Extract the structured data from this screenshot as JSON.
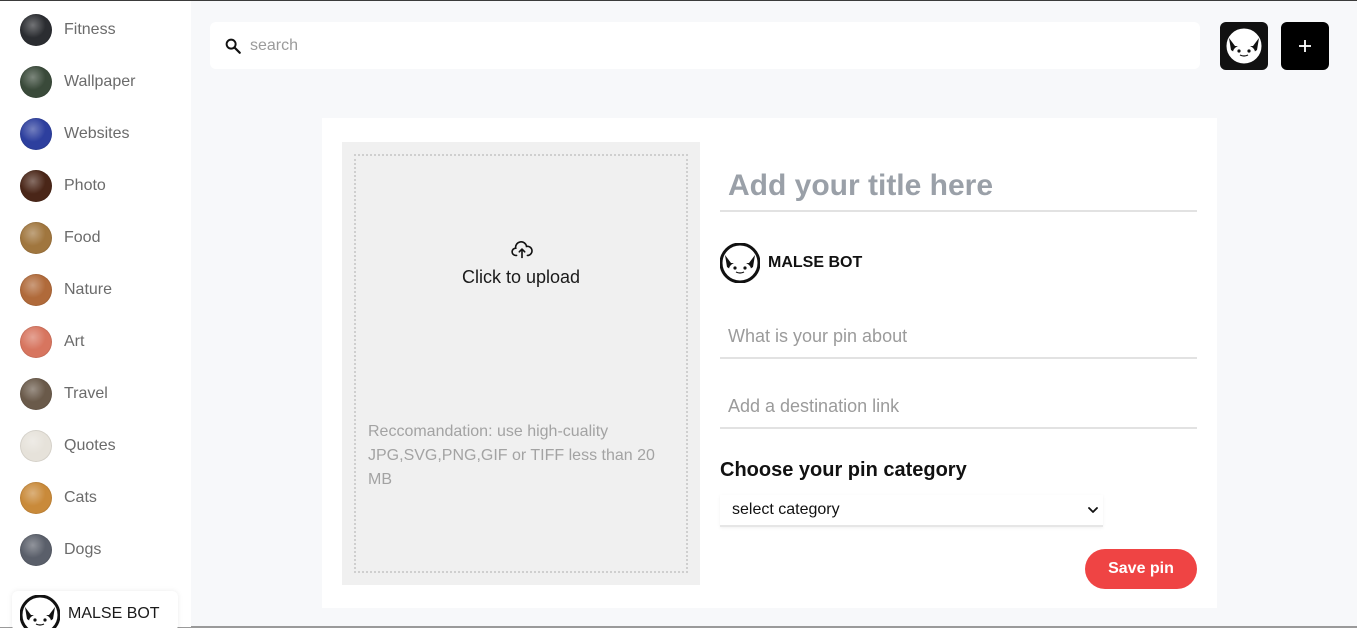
{
  "sidebar": {
    "categories": [
      {
        "label": "Fitness",
        "color": "#2b2d31"
      },
      {
        "label": "Wallpaper",
        "color": "#3a4a3a"
      },
      {
        "label": "Websites",
        "color": "#2d3f9e"
      },
      {
        "label": "Photo",
        "color": "#4a2618"
      },
      {
        "label": "Food",
        "color": "#a0763e"
      },
      {
        "label": "Nature",
        "color": "#b06a3a"
      },
      {
        "label": "Art",
        "color": "#d7755f"
      },
      {
        "label": "Travel",
        "color": "#6a5a4a"
      },
      {
        "label": "Quotes",
        "color": "#e6e2da"
      },
      {
        "label": "Cats",
        "color": "#c98a3a"
      },
      {
        "label": "Dogs",
        "color": "#5a5f6a"
      }
    ],
    "user": {
      "name": "MALSE BOT"
    }
  },
  "header": {
    "search_placeholder": "search",
    "create_icon": "plus-icon",
    "profile_icon": "malse-bot-avatar"
  },
  "upload": {
    "label": "Click to upload",
    "icon": "cloud-upload-icon",
    "note": "Reccomandation: use high-cuality JPG,SVG,PNG,GIF or TIFF less than 20 MB"
  },
  "form": {
    "title_placeholder": "Add your title here",
    "author_name": "MALSE BOT",
    "about_placeholder": "What is your pin about",
    "link_placeholder": "Add a destination link",
    "category_heading": "Choose your pin category",
    "category_selected": "select category",
    "save_label": "Save pin"
  },
  "colors": {
    "accent": "#ef4444",
    "background": "#f7f8fa"
  }
}
